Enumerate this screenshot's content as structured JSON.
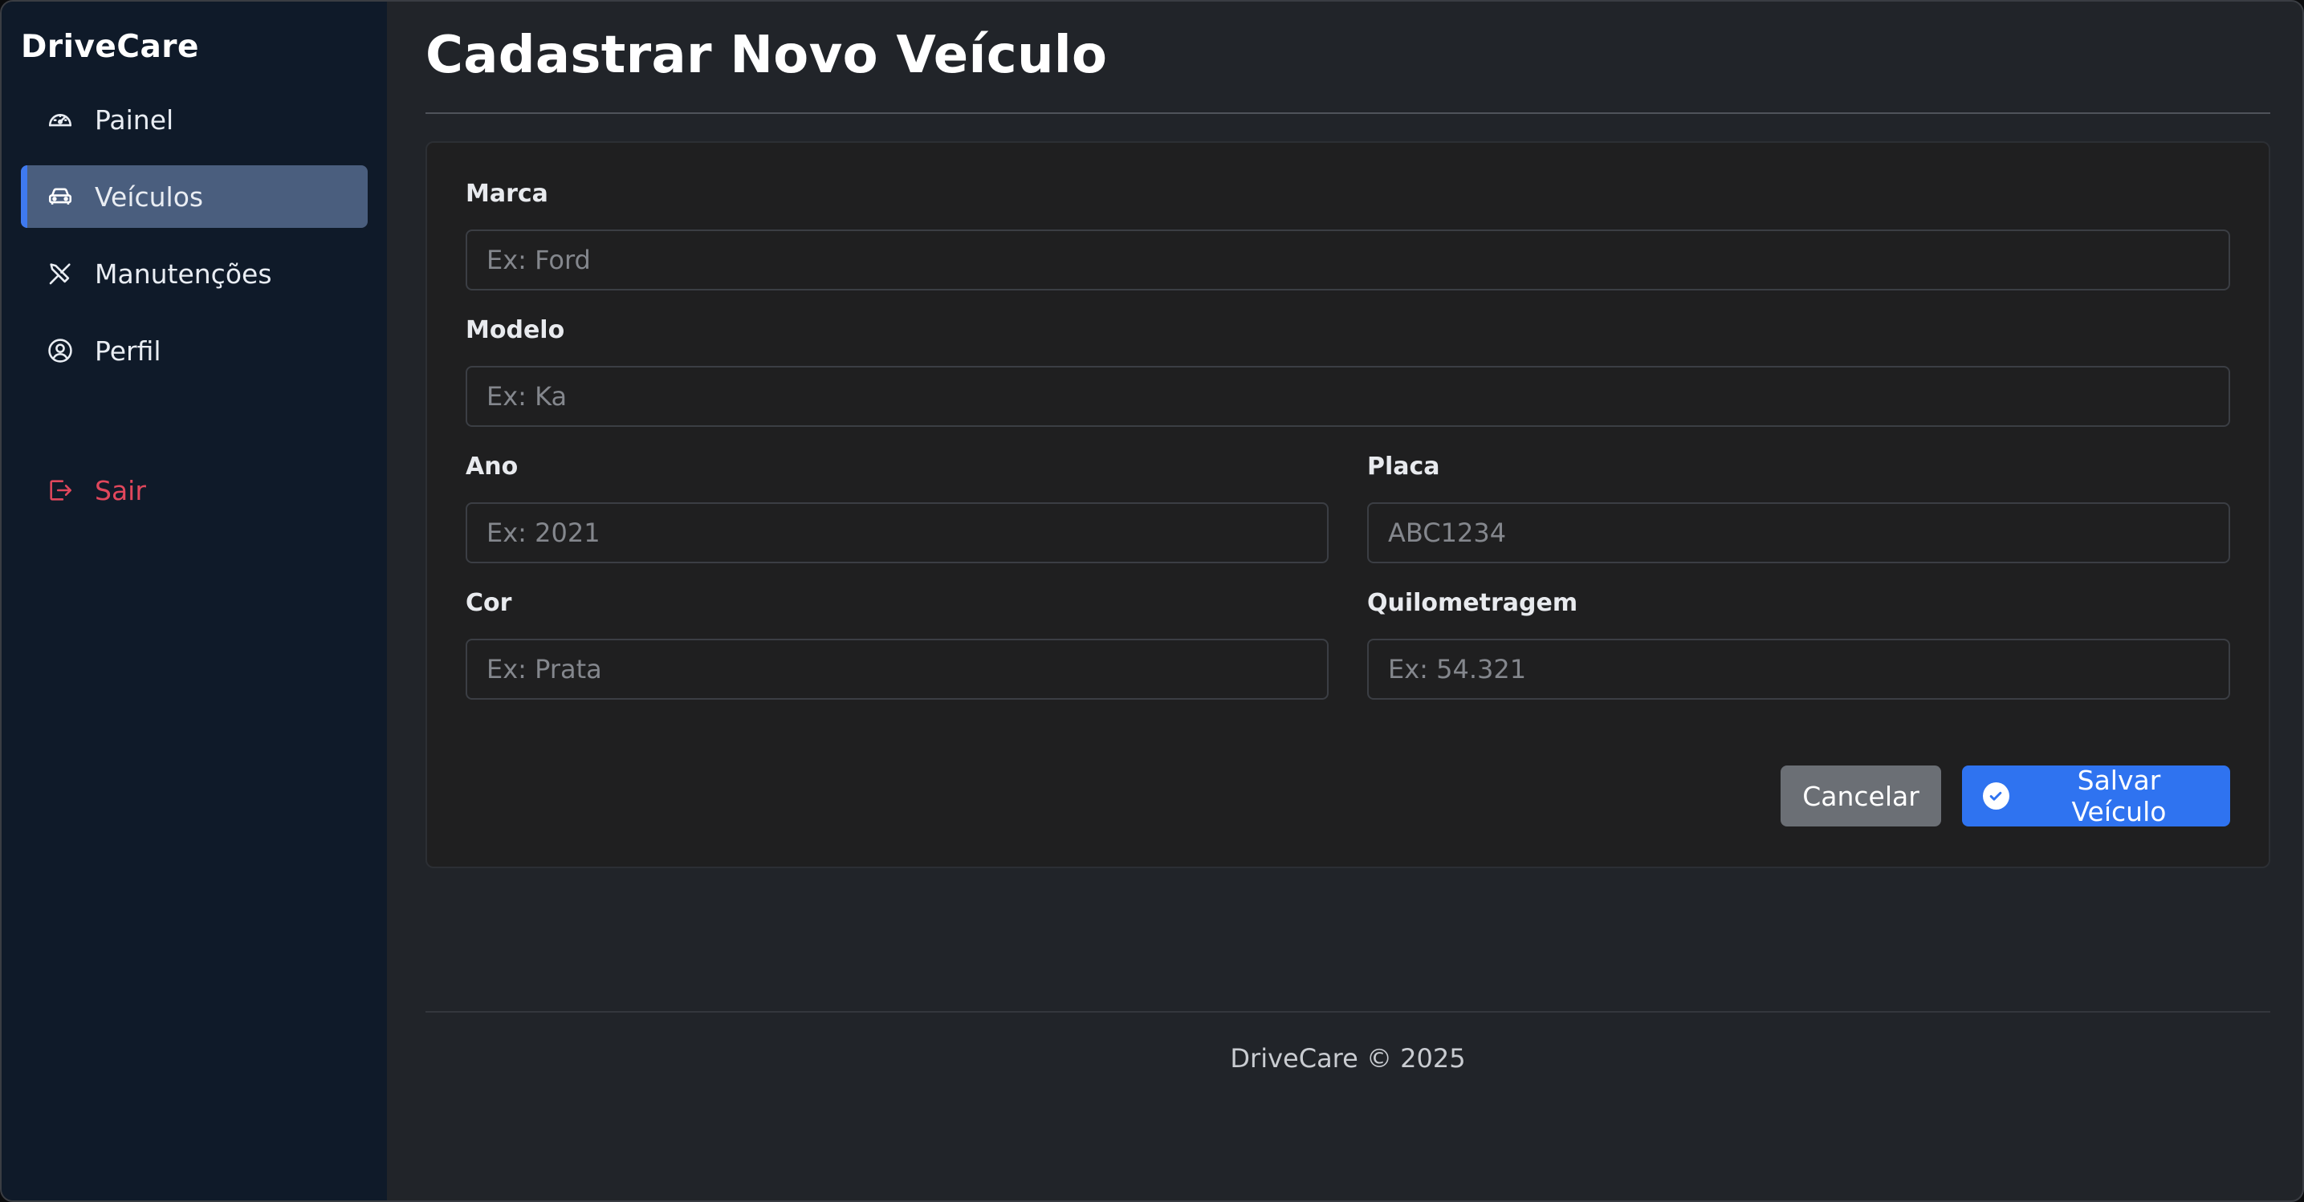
{
  "app": {
    "brand": "DriveCare"
  },
  "sidebar": {
    "items": [
      {
        "label": "Painel",
        "icon": "gauge-icon"
      },
      {
        "label": "Veículos",
        "icon": "car-icon",
        "active": true
      },
      {
        "label": "Manutenções",
        "icon": "wrench-screwdriver-icon"
      },
      {
        "label": "Perfil",
        "icon": "user-circle-icon"
      }
    ],
    "logout": {
      "label": "Sair",
      "icon": "logout-icon"
    }
  },
  "page": {
    "title": "Cadastrar Novo Veículo"
  },
  "form": {
    "marca": {
      "label": "Marca",
      "placeholder": "Ex: Ford",
      "value": ""
    },
    "modelo": {
      "label": "Modelo",
      "placeholder": "Ex: Ka",
      "value": ""
    },
    "ano": {
      "label": "Ano",
      "placeholder": "Ex: 2021",
      "value": ""
    },
    "placa": {
      "label": "Placa",
      "placeholder": "ABC1234",
      "value": ""
    },
    "cor": {
      "label": "Cor",
      "placeholder": "Ex: Prata",
      "value": ""
    },
    "quilometragem": {
      "label": "Quilometragem",
      "placeholder": "Ex: 54.321",
      "value": ""
    },
    "cancel_label": "Cancelar",
    "save_label": "Salvar Veículo"
  },
  "footer": {
    "text": "DriveCare © 2025"
  },
  "colors": {
    "sidebar_bg": "#0f1a29",
    "active_bg": "#4a5e7e",
    "accent": "#2f73f0",
    "logout": "#e0475c"
  }
}
